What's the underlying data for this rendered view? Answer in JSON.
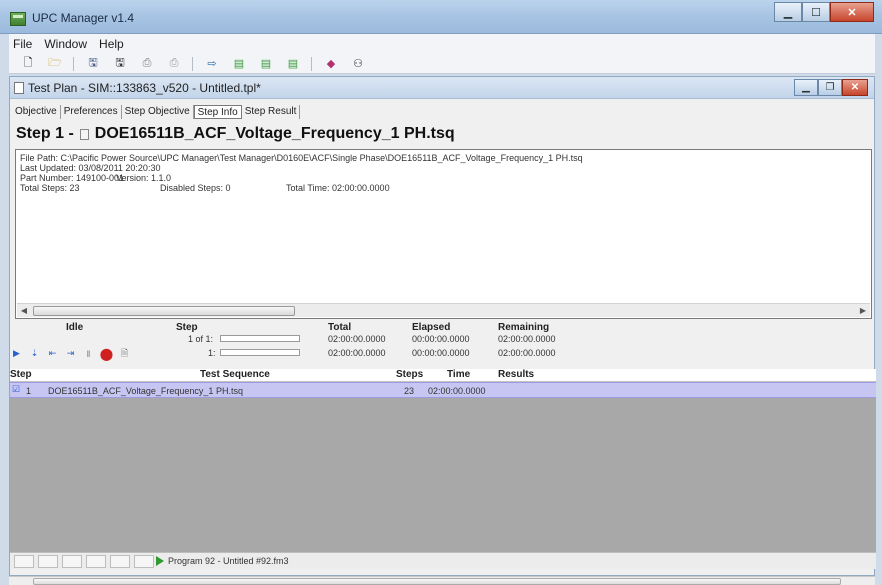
{
  "app": {
    "title": "UPC Manager v1.4"
  },
  "menu": [
    "File",
    "Window",
    "Help"
  ],
  "toolbar_icons": [
    "new-icon",
    "open-icon",
    "save-icon",
    "save-all-icon",
    "print-icon",
    "print-preview-icon",
    "export-icon",
    "transfer-icon",
    "import-icon",
    "monitor-icon",
    "eraser-icon",
    "help-icon"
  ],
  "inner_window": {
    "title": "Test Plan - SIM::133863_v520 - Untitled.tpl*",
    "tabs": [
      "Objective",
      "Preferences",
      "Step Objective",
      "Step Info",
      "Step Result"
    ],
    "active_tab": "Step Info"
  },
  "step": {
    "prefix": "Step 1 -",
    "filename": "DOE16511B_ACF_Voltage_Frequency_1 PH.tsq",
    "info": {
      "file_path": "File Path: C:\\Pacific Power Source\\UPC Manager\\Test Manager\\D0160E\\ACF\\Single Phase\\DOE16511B_ACF_Voltage_Frequency_1 PH.tsq",
      "last_updated": "Last Updated: 03/08/2011 20:20:30",
      "part_number": "Part Number: 149100-001",
      "version": "Version: 1.1.0",
      "total_steps": "Total Steps: 23",
      "disabled_steps": "Disabled Steps: 0",
      "total_time": "Total Time: 02:00:00.0000"
    }
  },
  "status": {
    "state": "Idle",
    "headers": {
      "step": "Step",
      "total": "Total",
      "elapsed": "Elapsed",
      "remaining": "Remaining"
    },
    "row1": {
      "step": "1 of 1:",
      "total": "02:00:00.0000",
      "elapsed": "00:00:00.0000",
      "remaining": "02:00:00.0000"
    },
    "row2": {
      "step": "1:",
      "total": "02:00:00.0000",
      "elapsed": "00:00:00.0000",
      "remaining": "02:00:00.0000"
    }
  },
  "table": {
    "columns": {
      "step": "Step",
      "sequence": "Test Sequence",
      "steps": "Steps",
      "time": "Time",
      "results": "Results"
    },
    "rows": [
      {
        "checked": true,
        "num": "1",
        "sequence": "DOE16511B_ACF_Voltage_Frequency_1 PH.tsq",
        "steps": "23",
        "time": "02:00:00.0000",
        "results": ""
      }
    ]
  },
  "bottom_status": {
    "program": "Program 92 - Untitled #92.fm3"
  }
}
